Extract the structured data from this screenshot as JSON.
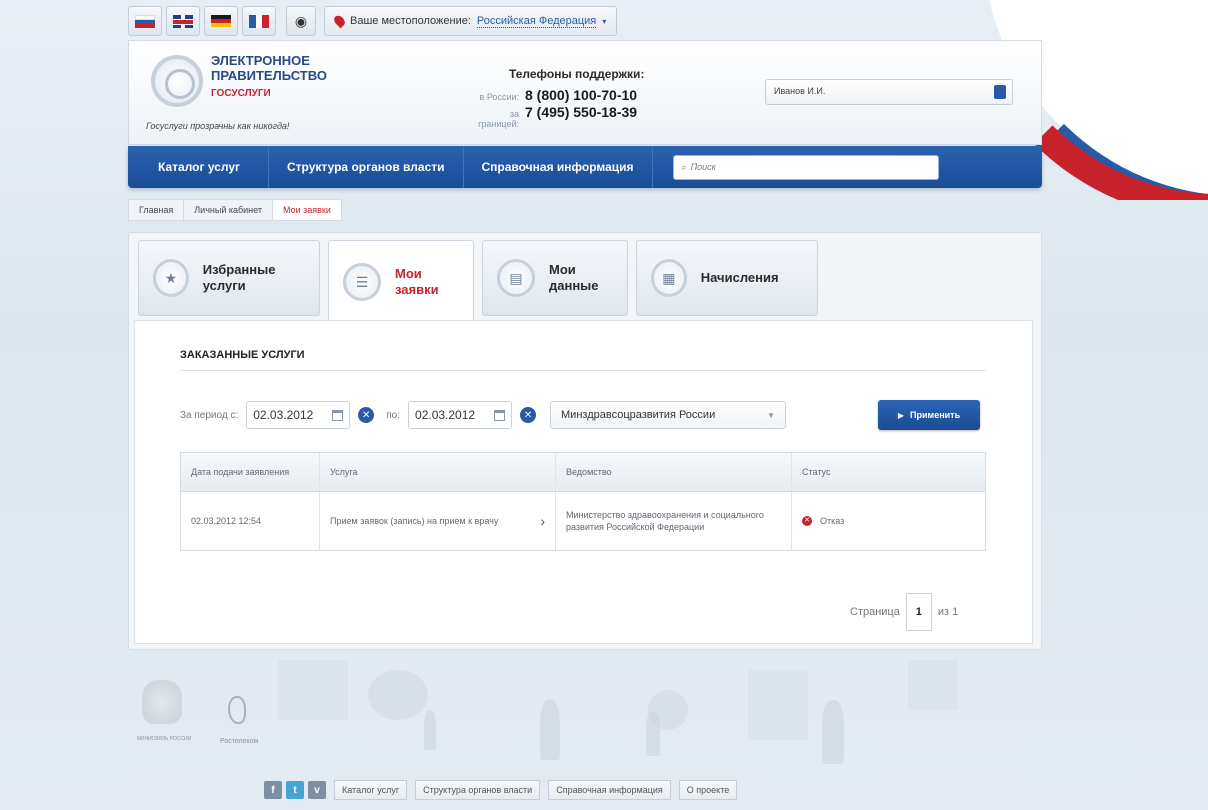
{
  "languages": [
    {
      "name": "ru",
      "colors": [
        "#ffffff",
        "#2a5aa6",
        "#c8232d"
      ]
    },
    {
      "name": "en"
    },
    {
      "name": "de",
      "colors": [
        "#1a1a1a",
        "#c8232d",
        "#f2c200"
      ]
    },
    {
      "name": "fr",
      "colors": [
        "#2a5aa6",
        "#ffffff",
        "#c8232d"
      ]
    }
  ],
  "location": {
    "label": "Ваше местоположение:",
    "value": "Российская Федерация"
  },
  "header": {
    "logo_line1": "ЭЛЕКТРОННОЕ",
    "logo_line2": "ПРАВИТЕЛЬСТВО",
    "logo_line3": "ГОСУСЛУГИ",
    "tagline": "Госуслуги прозрачны как никогда!",
    "support_title": "Телефоны поддержки:",
    "phone_ru_label": "в России:",
    "phone_ru": "8 (800) 100-70-10",
    "phone_abroad_label": "за границей:",
    "phone_abroad": "7 (495) 550-18-39",
    "user": "Иванов И.И."
  },
  "nav": {
    "items": [
      "Каталог услуг",
      "Структура органов власти",
      "Справочная информация"
    ],
    "search_placeholder": "Поиск"
  },
  "breadcrumbs": [
    "Главная",
    "Личный кабинет",
    "Мои заявки"
  ],
  "tabs": [
    {
      "label": "Избранные услуги",
      "icon": "star-icon"
    },
    {
      "label": "Мои заявки",
      "icon": "list-icon"
    },
    {
      "label": "Мои данные",
      "icon": "user-data-icon"
    },
    {
      "label": "Начисления",
      "icon": "calculator-icon"
    }
  ],
  "section_title": "ЗАКАЗАННЫЕ УСЛУГИ",
  "filters": {
    "period_label": "За период с:",
    "date_from": "02.03.2012",
    "to_label": "по:",
    "date_to": "02.03.2012",
    "department": "Минздравсоцразвития России",
    "apply_label": "Применить"
  },
  "table": {
    "headers": [
      "Дата подачи заявления",
      "Услуга",
      "Ведомство",
      "Статус"
    ],
    "rows": [
      {
        "date": "02.03.2012 12:54",
        "service": "Прием заявок (запись) на прием к врачу",
        "agency": "Министерство здравоохранения и социального развития Российской Федерации",
        "status": "Отказ"
      }
    ]
  },
  "pager": {
    "label": "Страница",
    "current": "1",
    "of": "из 1"
  },
  "footer": {
    "emblem_text": "МИНИСВЯЗЬ РОССИИ",
    "partner": "Ростелеком",
    "social": [
      "f",
      "t",
      "v"
    ],
    "links": [
      "Каталог услуг",
      "Структура органов власти",
      "Справочная информация",
      "О проекте"
    ]
  },
  "colors": {
    "accent_blue": "#2a5aa6",
    "accent_red": "#c8232d"
  }
}
